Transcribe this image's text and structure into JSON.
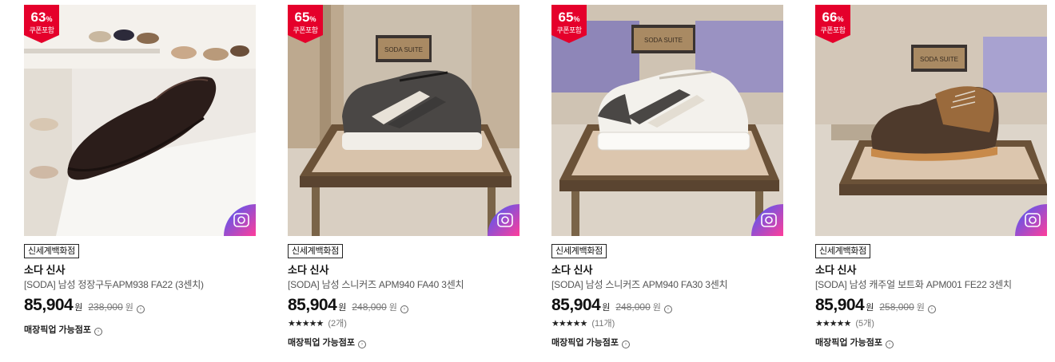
{
  "products": [
    {
      "discount": "63",
      "discount_unit": "%",
      "coupon_label": "쿠폰포함",
      "store_tag": "신세계백화점",
      "brand": "소다 신사",
      "name": "[SODA] 남성 정장구두APM938 FA22 (3센치)",
      "price": "85,904",
      "price_unit": "원",
      "original_price": "238,000",
      "original_unit": "원",
      "rating_stars": "",
      "review_count": "",
      "pickup_label": "매장픽업 가능점포",
      "image_icon": "dress-shoe-photo"
    },
    {
      "discount": "65",
      "discount_unit": "%",
      "coupon_label": "쿠폰포함",
      "store_tag": "신세계백화점",
      "brand": "소다 신사",
      "name": "[SODA] 남성 스니커즈 APM940 FA40 3센치",
      "price": "85,904",
      "price_unit": "원",
      "original_price": "248,000",
      "original_unit": "원",
      "rating_stars": "★★★★★",
      "review_count": "(2개)",
      "pickup_label": "매장픽업 가능점포",
      "display_sign": "SODA SUITE",
      "image_icon": "dark-sneaker-photo"
    },
    {
      "discount": "65",
      "discount_unit": "%",
      "coupon_label": "쿠폰포함",
      "store_tag": "신세계백화점",
      "brand": "소다 신사",
      "name": "[SODA] 남성 스니커즈 APM940 FA30 3센치",
      "price": "85,904",
      "price_unit": "원",
      "original_price": "248,000",
      "original_unit": "원",
      "rating_stars": "★★★★★",
      "review_count": "(11개)",
      "pickup_label": "매장픽업 가능점포",
      "display_sign": "SODA SUITE",
      "image_icon": "white-sneaker-photo"
    },
    {
      "discount": "66",
      "discount_unit": "%",
      "coupon_label": "쿠폰포함",
      "store_tag": "신세계백화점",
      "brand": "소다 신사",
      "name": "[SODA] 남성 캐주얼 보트화 APM001 FE22 3센치",
      "price": "85,904",
      "price_unit": "원",
      "original_price": "258,000",
      "original_unit": "원",
      "rating_stars": "★★★★★",
      "review_count": "(5개)",
      "pickup_label": "매장픽업 가능점포",
      "display_sign": "SODA SUITE",
      "image_icon": "boat-shoe-photo"
    }
  ],
  "colors": {
    "badge_red": "#e5002b",
    "camera_gradient_start": "#3b5cff",
    "camera_gradient_end": "#ff3d9a"
  }
}
